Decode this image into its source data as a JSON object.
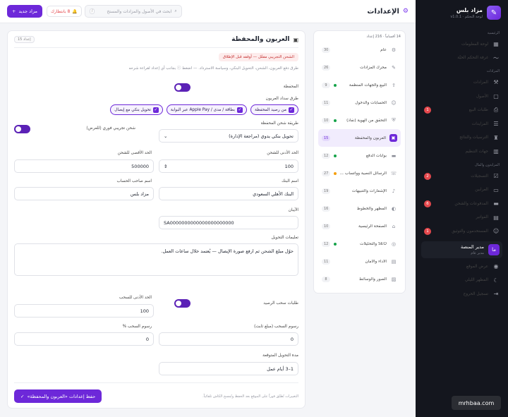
{
  "app": {
    "name": "مزاد بلس",
    "subtitle": "لوحة التحكم · v1.0.1",
    "logo_icon": "gavel-icon"
  },
  "topbar": {
    "title": "الإعدادات",
    "search_placeholder": "ابحث في الأصول والمزادات والمستخ",
    "search_kbd": "/",
    "notif_label": "8 بانتظارك",
    "new_button": "مزاد جديد"
  },
  "sidebar": {
    "sections": [
      {
        "title": "الرئيسية",
        "items": [
          {
            "label": "لوحة المعلومات",
            "icon": "grid-icon"
          },
          {
            "label": "غرفة التحكم الحيّة",
            "icon": "pulse-icon"
          }
        ]
      },
      {
        "title": "المزادات",
        "items": [
          {
            "label": "المزادات",
            "icon": "gavel-icon"
          },
          {
            "label": "الأصول",
            "icon": "box-icon"
          },
          {
            "label": "طلبات البيع",
            "icon": "inbox-icon",
            "badge": "1"
          },
          {
            "label": "المزايدات",
            "icon": "list-icon"
          },
          {
            "label": "الترسيات والنتائج",
            "icon": "trophy-icon"
          },
          {
            "label": "جهات التنظيم",
            "icon": "building-icon"
          }
        ]
      },
      {
        "title": "المزايدون والمال",
        "items": [
          {
            "label": "التسجيلات",
            "icon": "user-check-icon",
            "badge": "2"
          },
          {
            "label": "العرابين",
            "icon": "wallet-icon"
          },
          {
            "label": "المدفوعات والشحن",
            "icon": "card-icon",
            "badge": "6"
          },
          {
            "label": "الفواتير",
            "icon": "file-icon"
          },
          {
            "label": "المستخدمون والتوثيق",
            "icon": "users-icon",
            "badge": "1"
          }
        ]
      }
    ],
    "user": {
      "initial": "ما",
      "name": "مدير المنصة",
      "role": "مدير عام"
    },
    "footer_items": [
      {
        "label": "عرض الموقع",
        "icon": "eye-icon"
      },
      {
        "label": "المظهر الليلي",
        "icon": "moon-icon"
      },
      {
        "label": "تسجيل الخروج",
        "icon": "logout-icon"
      }
    ]
  },
  "settings_nav": {
    "summary": "14 أقساماً · 216 إعداد",
    "items": [
      {
        "label": "عام",
        "icon": "gear-icon",
        "count": "30"
      },
      {
        "label": "محرك المزادات",
        "icon": "pen-icon",
        "count": "26"
      },
      {
        "label": "البيع والجهات المنظّمة",
        "icon": "upload-icon",
        "count": "9",
        "dot": "#16a34a"
      },
      {
        "label": "الحسابات والدخول",
        "icon": "users-icon",
        "count": "11"
      },
      {
        "label": "التحقق من الهوية (نفاذ)",
        "icon": "shield-icon",
        "count": "10",
        "dot": "#16a34a"
      },
      {
        "label": "العربون والمحفظة",
        "icon": "wallet-icon",
        "count": "15",
        "active": true
      },
      {
        "label": "بوابات الدفع",
        "icon": "card-icon",
        "count": "12",
        "dot": "#16a34a"
      },
      {
        "label": "الرسائل النصية وواتساب ...",
        "icon": "phone-icon",
        "count": "27",
        "dot": "#f59e0b"
      },
      {
        "label": "الإشعارات والتنبيهات",
        "icon": "bell-icon",
        "count": "19"
      },
      {
        "label": "المظهر والخطوط",
        "icon": "palette-icon",
        "count": "16"
      },
      {
        "label": "الصفحة الرئيسية",
        "icon": "home-icon",
        "count": "10"
      },
      {
        "label": "SEO والتحليلات",
        "icon": "globe-icon",
        "count": "12",
        "dot": "#16a34a"
      },
      {
        "label": "الأداء والأمان",
        "icon": "lock-icon",
        "count": "11"
      },
      {
        "label": "الصور والوسائط",
        "icon": "image-icon",
        "count": "8"
      }
    ]
  },
  "form": {
    "title": "العربون والمحفظة",
    "count_tag": "إعداد 15",
    "alert": "الشحن التجريبي مفعّل — أوقفه قبل الإطلاق",
    "help": "طرق دفع العربون، الشحن، التحويل البنكي، وسياسة الاسترداد. — اضغط ⓘ بجانب أي إعداد لقراءة شرحه",
    "wallet_label": "المحفظة",
    "topup_methods_label": "طرق سداد العربون",
    "topup_methods": [
      "من رصيد المحفظة",
      "بطاقة / مدى / Apple Pay عبر البوابة",
      "تحويل بنكي مع إيصال"
    ],
    "topup_method_label": "طريقة شحن المحفظة",
    "topup_method_value": "تحويل بنكي يدوي (مراجعة الإدارة)",
    "instant_test_label": "شحن تجريبي فوري (للعرض)",
    "min_topup_label": "الحد الأدنى للشحن",
    "min_topup_value": "100",
    "max_topup_label": "الحد الأقصى للشحن",
    "max_topup_value": "500000",
    "bank_name_label": "اسم البنك",
    "bank_name_value": "البنك الأهلي السعودي",
    "account_holder_label": "اسم صاحب الحساب",
    "account_holder_value": "مزاد بلس",
    "iban_label": "الآيبان",
    "iban_value": "SA0000000000000000000000",
    "instructions_label": "تعليمات التحويل",
    "instructions_value": "حوّل مبلغ الشحن ثم ارفع صورة الإيصال — يُعتمد خلال ساعات العمل.",
    "withdraw_label": "طلبات سحب الرصيد",
    "min_withdraw_label": "الحد الأدنى للسحب",
    "min_withdraw_value": "100",
    "withdraw_fee_fixed_label": "رسوم السحب (مبلغ ثابت)",
    "withdraw_fee_fixed_value": "0",
    "withdraw_fee_pct_label": "رسوم السحب %",
    "withdraw_fee_pct_value": "0",
    "expected_time_label": "مدة التحويل المتوقعة",
    "expected_time_value": "1–3 أيام عمل",
    "footer_note": "التغييرات تُطبّق فوراً على الموقع بعد الحفظ وتُمسح الكاش تلقائياً.",
    "save_button": "حفظ إعدادات «العربون والمحفظة»"
  },
  "watermark": "mrhbaa.com"
}
